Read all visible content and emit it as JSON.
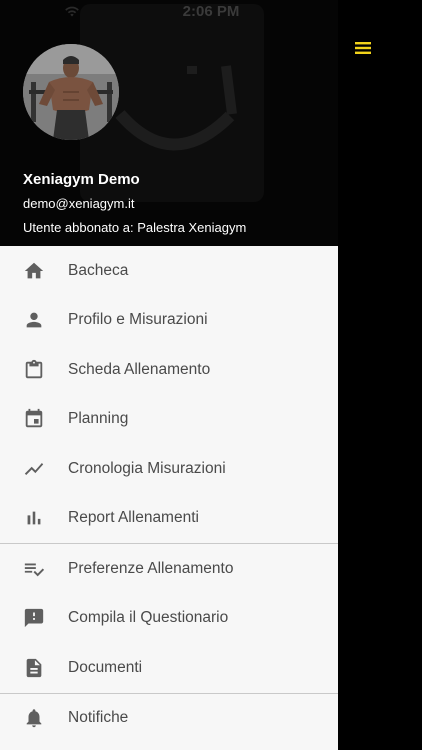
{
  "status_bar": {
    "time": "2:06 PM",
    "wifi_icon": "wifi-icon"
  },
  "menu_button": {
    "icon": "hamburger-menu-icon",
    "color": "#f2d31b"
  },
  "profile": {
    "name": "Xeniagym Demo",
    "email": "demo@xeniagym.it",
    "subscription": "Utente abbonato a: Palestra Xeniagym"
  },
  "menu_groups": [
    {
      "items": [
        {
          "label": "Bacheca",
          "icon": "home-icon"
        },
        {
          "label": "Profilo e Misurazioni",
          "icon": "person-icon"
        },
        {
          "label": "Scheda Allenamento",
          "icon": "clipboard-icon"
        },
        {
          "label": "Planning",
          "icon": "calendar-icon"
        },
        {
          "label": "Cronologia Misurazioni",
          "icon": "trending-line-icon"
        },
        {
          "label": "Report Allenamenti",
          "icon": "bar-chart-icon"
        }
      ]
    },
    {
      "items": [
        {
          "label": "Preferenze Allenamento",
          "icon": "playlist-check-icon"
        },
        {
          "label": "Compila il Questionario",
          "icon": "feedback-icon"
        },
        {
          "label": "Documenti",
          "icon": "document-icon"
        }
      ]
    },
    {
      "items": [
        {
          "label": "Notifiche",
          "icon": "bell-icon"
        }
      ]
    }
  ]
}
